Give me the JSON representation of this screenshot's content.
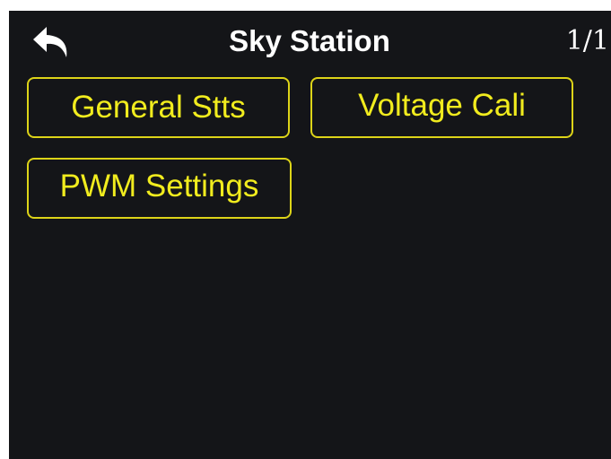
{
  "header": {
    "back_icon": "back-arrow-icon",
    "title": "Sky Station",
    "page_indicator": "1/1"
  },
  "menu": {
    "items": [
      {
        "label": "General Stts"
      },
      {
        "label": "Voltage Cali"
      },
      {
        "label": "PWM Settings"
      }
    ]
  },
  "colors": {
    "background": "#141518",
    "accent": "#f1ec1e",
    "border": "#ddd418",
    "text": "#ffffff"
  }
}
